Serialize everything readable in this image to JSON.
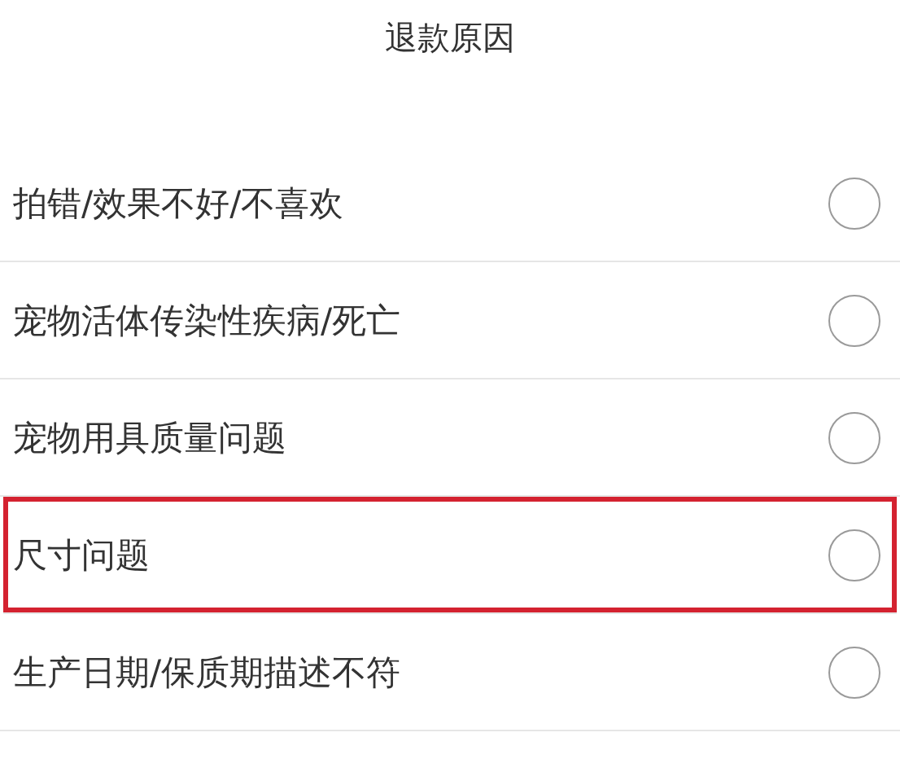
{
  "header": {
    "title": "退款原因"
  },
  "reasons": [
    {
      "label": "拍错/效果不好/不喜欢",
      "selected": false,
      "highlighted": false
    },
    {
      "label": "宠物活体传染性疾病/死亡",
      "selected": false,
      "highlighted": false
    },
    {
      "label": "宠物用具质量问题",
      "selected": false,
      "highlighted": false
    },
    {
      "label": "尺寸问题",
      "selected": false,
      "highlighted": true
    },
    {
      "label": "生产日期/保质期描述不符",
      "selected": false,
      "highlighted": false
    }
  ]
}
